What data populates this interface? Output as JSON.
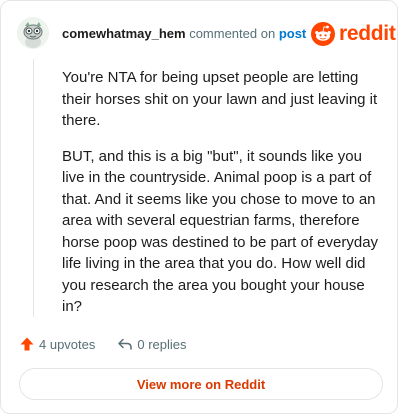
{
  "header": {
    "username": "comewhatmay_hem",
    "action_text": "commented on",
    "post_link": "post"
  },
  "brand": {
    "wordmark": "reddit",
    "icon": "reddit-alien-icon",
    "color": "#ff4500"
  },
  "comment": {
    "paragraphs": [
      "You're NTA for being upset people are letting their horses shit on your lawn and just leaving it there.",
      "BUT, and this is a big \"but\", it sounds like you live in the countryside. Animal poop is a part of that. And it seems like you chose to move to an area with several equestrian farms, therefore horse poop was destined to be part of everyday life living in the area that you do. How well did you research the area you bought your house in?"
    ]
  },
  "footer": {
    "upvotes_label": "4 upvotes",
    "upvote_icon": "upvote-arrow-icon",
    "replies_label": "0 replies",
    "reply_icon": "reply-arrow-icon"
  },
  "cta": {
    "view_more_label": "View more on Reddit"
  },
  "colors": {
    "accent": "#ff4500",
    "link": "#0079d3",
    "muted": "#576f76",
    "cta_text": "#d93a00",
    "border": "#e3e6e8"
  }
}
